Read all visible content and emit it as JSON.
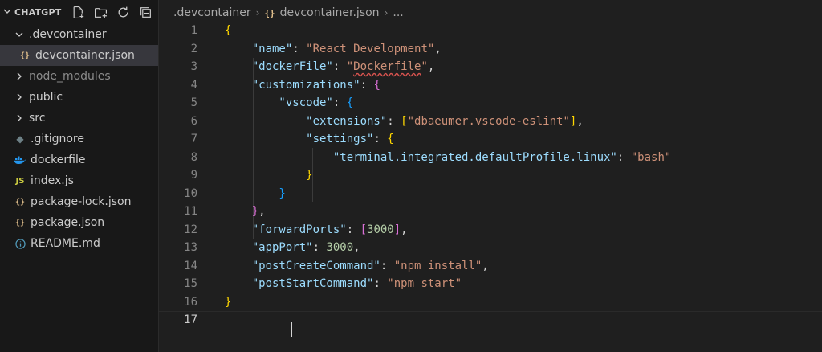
{
  "explorer": {
    "title": "CHATGPT",
    "actions": [
      "new-file-icon",
      "new-folder-icon",
      "refresh-icon",
      "collapse-all-icon"
    ],
    "items": [
      {
        "label": ".devcontainer",
        "kind": "folder-open",
        "level": 0
      },
      {
        "label": "devcontainer.json",
        "kind": "json",
        "level": 1,
        "selected": true
      },
      {
        "label": "node_modules",
        "kind": "folder",
        "level": 0,
        "muted": true
      },
      {
        "label": "public",
        "kind": "folder",
        "level": 0
      },
      {
        "label": "src",
        "kind": "folder",
        "level": 0
      },
      {
        "label": ".gitignore",
        "kind": "git",
        "level": 0
      },
      {
        "label": "dockerfile",
        "kind": "docker",
        "level": 0
      },
      {
        "label": "index.js",
        "kind": "js",
        "level": 0
      },
      {
        "label": "package-lock.json",
        "kind": "json",
        "level": 0
      },
      {
        "label": "package.json",
        "kind": "json",
        "level": 0
      },
      {
        "label": "README.md",
        "kind": "info",
        "level": 0
      }
    ]
  },
  "breadcrumb": {
    "folder": ".devcontainer",
    "file": "devcontainer.json",
    "rest": "..."
  },
  "code": {
    "active_line": 17,
    "lines": [
      [
        {
          "t": "{",
          "c": "b1"
        }
      ],
      [
        {
          "t": "    \"name\"",
          "c": "k"
        },
        {
          "t": ": ",
          "c": "p"
        },
        {
          "t": "\"React Development\"",
          "c": "s"
        },
        {
          "t": ",",
          "c": "p"
        }
      ],
      [
        {
          "t": "    \"dockerFile\"",
          "c": "k"
        },
        {
          "t": ": ",
          "c": "p"
        },
        {
          "t": "\"",
          "c": "s"
        },
        {
          "t": "Dockerfile",
          "c": "s squig"
        },
        {
          "t": "\"",
          "c": "s"
        },
        {
          "t": ",",
          "c": "p"
        }
      ],
      [
        {
          "t": "    \"customizations\"",
          "c": "k"
        },
        {
          "t": ": ",
          "c": "p"
        },
        {
          "t": "{",
          "c": "b2"
        }
      ],
      [
        {
          "t": "        \"vscode\"",
          "c": "k"
        },
        {
          "t": ": ",
          "c": "p"
        },
        {
          "t": "{",
          "c": "b3"
        }
      ],
      [
        {
          "t": "            \"extensions\"",
          "c": "k"
        },
        {
          "t": ": ",
          "c": "p"
        },
        {
          "t": "[",
          "c": "b1"
        },
        {
          "t": "\"dbaeumer.vscode-eslint\"",
          "c": "s"
        },
        {
          "t": "]",
          "c": "b1"
        },
        {
          "t": ",",
          "c": "p"
        }
      ],
      [
        {
          "t": "            \"settings\"",
          "c": "k"
        },
        {
          "t": ": ",
          "c": "p"
        },
        {
          "t": "{",
          "c": "b1"
        }
      ],
      [
        {
          "t": "                \"terminal.integrated.defaultProfile.linux\"",
          "c": "k"
        },
        {
          "t": ": ",
          "c": "p"
        },
        {
          "t": "\"bash\"",
          "c": "s"
        }
      ],
      [
        {
          "t": "            }",
          "c": "b1"
        }
      ],
      [
        {
          "t": "        }",
          "c": "b3"
        }
      ],
      [
        {
          "t": "    }",
          "c": "b2"
        },
        {
          "t": ",",
          "c": "p"
        }
      ],
      [
        {
          "t": "    \"forwardPorts\"",
          "c": "k"
        },
        {
          "t": ": ",
          "c": "p"
        },
        {
          "t": "[",
          "c": "b2"
        },
        {
          "t": "3000",
          "c": "n"
        },
        {
          "t": "]",
          "c": "b2"
        },
        {
          "t": ",",
          "c": "p"
        }
      ],
      [
        {
          "t": "    \"appPort\"",
          "c": "k"
        },
        {
          "t": ": ",
          "c": "p"
        },
        {
          "t": "3000",
          "c": "n"
        },
        {
          "t": ",",
          "c": "p"
        }
      ],
      [
        {
          "t": "    \"postCreateCommand\"",
          "c": "k"
        },
        {
          "t": ": ",
          "c": "p"
        },
        {
          "t": "\"npm install\"",
          "c": "s"
        },
        {
          "t": ",",
          "c": "p"
        }
      ],
      [
        {
          "t": "    \"postStartCommand\"",
          "c": "k"
        },
        {
          "t": ": ",
          "c": "p"
        },
        {
          "t": "\"npm start\"",
          "c": "s"
        }
      ],
      [
        {
          "t": "}",
          "c": "b1"
        }
      ],
      []
    ]
  }
}
